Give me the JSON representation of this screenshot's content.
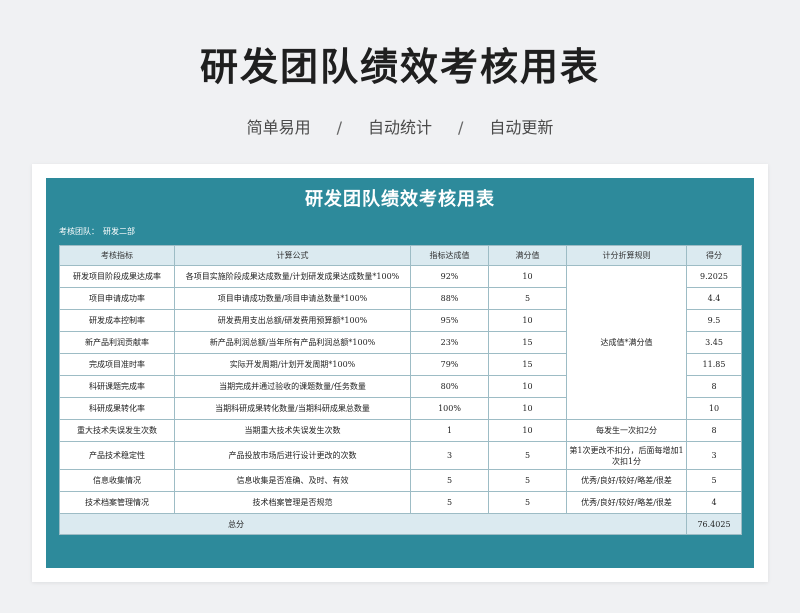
{
  "hero": {
    "title": "研发团队绩效考核用表",
    "tags": [
      "简单易用",
      "自动统计",
      "自动更新"
    ],
    "separator": "/"
  },
  "sheet": {
    "title": "研发团队绩效考核用表",
    "team_label": "考核团队：",
    "team_value": "研发二部",
    "headers": [
      "考核指标",
      "计算公式",
      "指标达成值",
      "满分值",
      "计分折算规则",
      "得分"
    ],
    "rows": [
      {
        "indicator": "研发项目阶段成果达成率",
        "formula": "各项目实施阶段成果达成数量/计划研发成果达成数量*100%",
        "achieved": "92%",
        "full": "10",
        "score": "9.2025"
      },
      {
        "indicator": "项目申请成功率",
        "formula": "项目申请成功数量/项目申请总数量*100%",
        "achieved": "88%",
        "full": "5",
        "score": "4.4"
      },
      {
        "indicator": "研发成本控制率",
        "formula": "研发费用支出总额/研发费用预算额*100%",
        "achieved": "95%",
        "full": "10",
        "score": "9.5"
      },
      {
        "indicator": "新产品利润贡献率",
        "formula": "新产品利润总额/当年所有产品利润总额*100%",
        "achieved": "23%",
        "full": "15",
        "score": "3.45"
      },
      {
        "indicator": "完成项目准时率",
        "formula": "实际开发周期/计划开发周期*100%",
        "achieved": "79%",
        "full": "15",
        "score": "11.85"
      },
      {
        "indicator": "科研课题完成率",
        "formula": "当期完成并通过验收的课题数量/任务数量",
        "achieved": "80%",
        "full": "10",
        "score": "8"
      },
      {
        "indicator": "科研成果转化率",
        "formula": "当期科研成果转化数量/当期科研成果总数量",
        "achieved": "100%",
        "full": "10",
        "score": "10"
      },
      {
        "indicator": "重大技术失误发生次数",
        "formula": "当期重大技术失误发生次数",
        "achieved": "1",
        "full": "10",
        "rule": "每发生一次扣2分",
        "score": "8"
      },
      {
        "indicator": "产品技术稳定性",
        "formula": "产品投放市场后进行设计更改的次数",
        "achieved": "3",
        "full": "5",
        "rule": "第1次更改不扣分，后面每增加1次扣1分",
        "score": "3"
      },
      {
        "indicator": "信息收集情况",
        "formula": "信息收集是否准确、及时、有效",
        "achieved": "5",
        "full": "5",
        "rule": "优秀/良好/较好/略差/很差",
        "score": "5"
      },
      {
        "indicator": "技术档案管理情况",
        "formula": "技术档案管理是否规范",
        "achieved": "5",
        "full": "5",
        "rule": "优秀/良好/较好/略差/很差",
        "score": "4"
      }
    ],
    "merged_rule": "达成值*满分值",
    "total_label": "总分",
    "total_value": "76.4025"
  }
}
